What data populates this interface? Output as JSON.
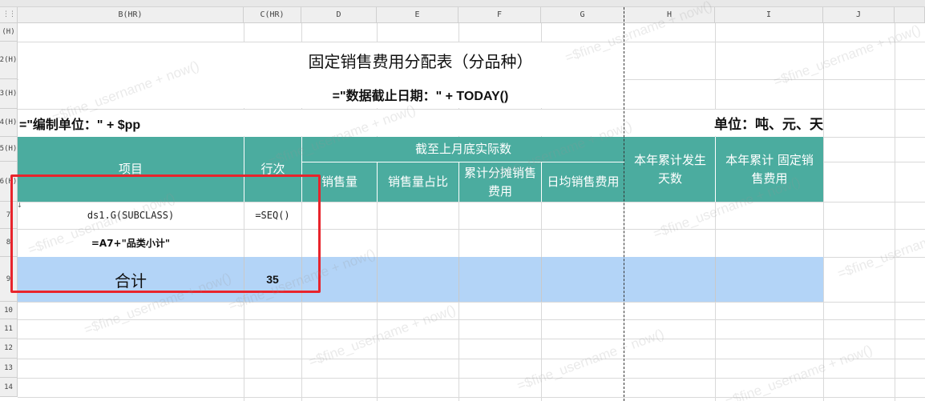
{
  "sheet": {
    "corner_icon": "grid-icon",
    "column_headers": [
      "B(HR)",
      "C(HR)",
      "D",
      "E",
      "F",
      "G",
      "H",
      "I",
      "J"
    ],
    "row_headers": [
      "(H)",
      "2(H)",
      "3(H)",
      "4(H)",
      "5(H)",
      "6(H)",
      "7",
      "8",
      "9",
      "10",
      "11",
      "12",
      "13",
      "14"
    ]
  },
  "report": {
    "title": "固定销售费用分配表（分品种）",
    "date_formula": "=\"数据截止日期：\" + TODAY()",
    "unit_formula": "=\"编制单位：\" + $pp",
    "unit_label": "单位：吨、元、天",
    "headers": {
      "item": "项目",
      "row_no": "行次",
      "actual_group": "截至上月底实际数",
      "sales_qty": "销售量",
      "sales_share": "销售量占比",
      "cum_cost": "累计分摊销售费用",
      "daily_cost": "日均销售费用",
      "ytd_days": "本年累计发生天数",
      "ytd_fixed": "本年累计 固定销售费用"
    },
    "rows": {
      "detail_item": "ds1.G(SUBCLASS)",
      "detail_seq": "=SEQ()",
      "subtotal_item": "=A7+\"品类小计\"",
      "total_label": "合计",
      "total_value": "35"
    }
  },
  "colors": {
    "header_fill": "#4bac9f",
    "total_fill": "#b3d4f7",
    "selection_border": "#e8242c"
  },
  "watermark": "=$fine_username + now()"
}
